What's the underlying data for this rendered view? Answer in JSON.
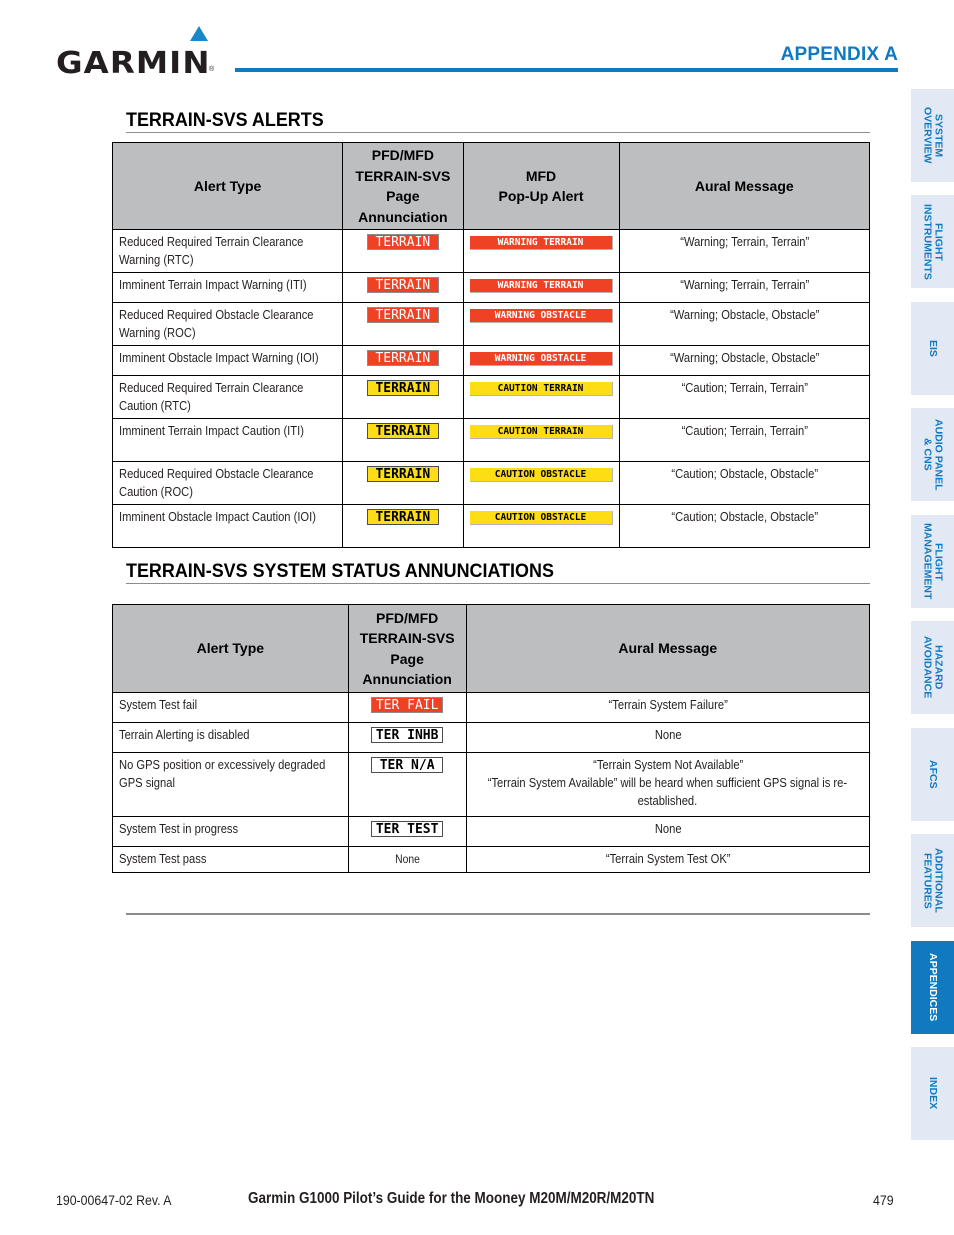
{
  "header": {
    "logo": "GARMIN",
    "logo_reg": "®",
    "appendix": "APPENDIX A"
  },
  "alerts_section": {
    "title": "TERRAIN-SVS ALERTS",
    "columns": [
      "Alert Type",
      "PFD/MFD TERRAIN-SVS Page Annunciation",
      "MFD Pop-Up Alert",
      "Aural Message"
    ],
    "column_lines": {
      "pfd": [
        "PFD/MFD",
        "TERRAIN-SVS",
        "Page",
        "Annunciation"
      ],
      "mfd": [
        "MFD",
        "Pop-Up Alert"
      ]
    },
    "rows": [
      {
        "alert_type": "Reduced Required Terrain Clearance Warning (RTC)",
        "pfd": "TERRAIN",
        "pfd_style": "red",
        "mfd": "WARNING TERRAIN",
        "mfd_style": "red",
        "aural": "“Warning; Terrain, Terrain”"
      },
      {
        "alert_type": "Imminent Terrain Impact Warning (ITI)",
        "pfd": "TERRAIN",
        "pfd_style": "red",
        "mfd": "WARNING TERRAIN",
        "mfd_style": "red",
        "aural": "“Warning; Terrain, Terrain”"
      },
      {
        "alert_type": "Reduced Required Obstacle Clearance Warning (ROC)",
        "pfd": "TERRAIN",
        "pfd_style": "red",
        "mfd": "WARNING OBSTACLE",
        "mfd_style": "red",
        "aural": "“Warning; Obstacle, Obstacle”"
      },
      {
        "alert_type": "Imminent Obstacle Impact Warning (IOI)",
        "pfd": "TERRAIN",
        "pfd_style": "red",
        "mfd": "WARNING OBSTACLE",
        "mfd_style": "red",
        "aural": "“Warning; Obstacle, Obstacle”"
      },
      {
        "alert_type": "Reduced Required Terrain Clearance Caution (RTC)",
        "pfd": "TERRAIN",
        "pfd_style": "yellow",
        "mfd": "CAUTION TERRAIN",
        "mfd_style": "yellow",
        "aural": "“Caution; Terrain, Terrain”"
      },
      {
        "alert_type": "Imminent Terrain Impact Caution (ITI)",
        "pfd": "TERRAIN",
        "pfd_style": "yellow",
        "mfd": "CAUTION TERRAIN",
        "mfd_style": "yellow",
        "aural": "“Caution; Terrain, Terrain”"
      },
      {
        "alert_type": "Reduced Required Obstacle Clearance Caution (ROC)",
        "pfd": "TERRAIN",
        "pfd_style": "yellow",
        "mfd": "CAUTION OBSTACLE",
        "mfd_style": "yellow",
        "aural": "“Caution; Obstacle, Obstacle”"
      },
      {
        "alert_type": "Imminent Obstacle Impact Caution (IOI)",
        "pfd": "TERRAIN",
        "pfd_style": "yellow",
        "mfd": "CAUTION OBSTACLE",
        "mfd_style": "yellow",
        "aural": "“Caution; Obstacle, Obstacle”"
      }
    ]
  },
  "status_section": {
    "title": "TERRAIN-SVS SYSTEM STATUS ANNUNCIATIONS",
    "columns": [
      "Alert Type",
      "PFD/MFD TERRAIN-SVS Page Annunciation",
      "Aural Message"
    ],
    "column_lines": {
      "pfd": [
        "PFD/MFD",
        "TERRAIN-SVS",
        "Page",
        "Annunciation"
      ]
    },
    "rows": [
      {
        "alert_type": "System Test fail",
        "pfd": "TER FAIL",
        "pfd_style": "red",
        "aural": [
          "“Terrain System Failure”"
        ]
      },
      {
        "alert_type": "Terrain Alerting is disabled",
        "pfd": "TER INHB",
        "pfd_style": "white",
        "aural": [
          "None"
        ]
      },
      {
        "alert_type": "No GPS position or excessively degraded GPS signal",
        "pfd": "TER N/A",
        "pfd_style": "white",
        "aural": [
          "“Terrain System Not Available”",
          "“Terrain System Available” will be heard when sufficient GPS signal is re-established."
        ]
      },
      {
        "alert_type": "System Test in progress",
        "pfd": "TER TEST",
        "pfd_style": "white",
        "aural": [
          "None"
        ]
      },
      {
        "alert_type": "System Test pass",
        "pfd": "None",
        "pfd_style": "none",
        "aural": [
          "“Terrain System Test OK”"
        ]
      }
    ]
  },
  "side_tabs": [
    {
      "label": "SYSTEM\nOVERVIEW",
      "active": false
    },
    {
      "label": "FLIGHT\nINSTRUMENTS",
      "active": false
    },
    {
      "label": "EIS",
      "active": false
    },
    {
      "label": "AUDIO PANEL\n& CNS",
      "active": false
    },
    {
      "label": "FLIGHT\nMANAGEMENT",
      "active": false
    },
    {
      "label": "HAZARD\nAVOIDANCE",
      "active": false
    },
    {
      "label": "AFCS",
      "active": false
    },
    {
      "label": "ADDITIONAL\nFEATURES",
      "active": false
    },
    {
      "label": "APPENDICES",
      "active": true
    },
    {
      "label": "INDEX",
      "active": false
    }
  ],
  "colors": {
    "brand_blue": "#0f7ac0",
    "warning_red": "#ef4123",
    "caution_yellow": "#ffdd15",
    "header_gray": "#bcbec0",
    "tab_bg": "#e3e8f5"
  },
  "footer": {
    "doc_number": "190-00647-02  Rev. A",
    "title": "Garmin G1000 Pilot’s Guide for the Mooney M20M/M20R/M20TN",
    "page_number": "479"
  }
}
